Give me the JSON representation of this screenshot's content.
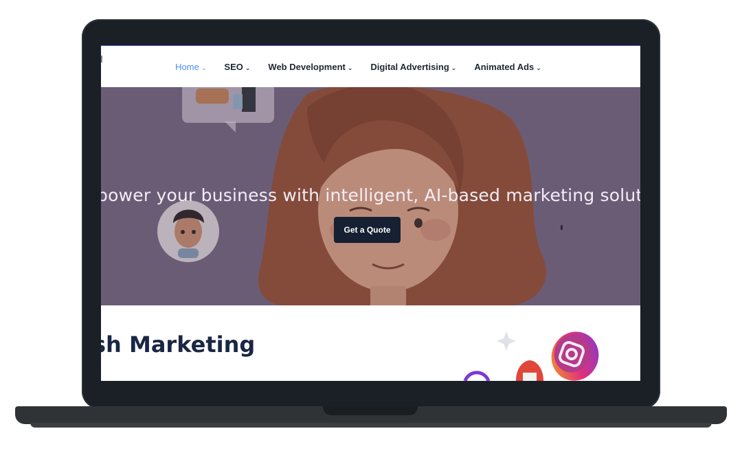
{
  "nav": {
    "items": [
      {
        "label": "Home",
        "chevron": "⌄",
        "active": true
      },
      {
        "label": "SEO",
        "chevron": "⌄",
        "active": false
      },
      {
        "label": "Web Development",
        "chevron": "⌄",
        "active": false
      },
      {
        "label": "Digital Advertising",
        "chevron": "⌄",
        "active": false
      },
      {
        "label": "Animated Ads",
        "chevron": "⌄",
        "active": false
      }
    ]
  },
  "hero": {
    "headline": "npower your business with intelligent, AI-based marketing soluti",
    "button_label": "Get a Quote"
  },
  "section": {
    "title": "sh Marketing"
  },
  "colors": {
    "nav_active": "#4a8ff0",
    "hero_bg": "#6e5e78",
    "button_bg": "#152032",
    "title": "#1a2744"
  },
  "icons": [
    "chevron-down-icon",
    "instagram-icon",
    "sparkle-icon",
    "rocket-icon"
  ]
}
